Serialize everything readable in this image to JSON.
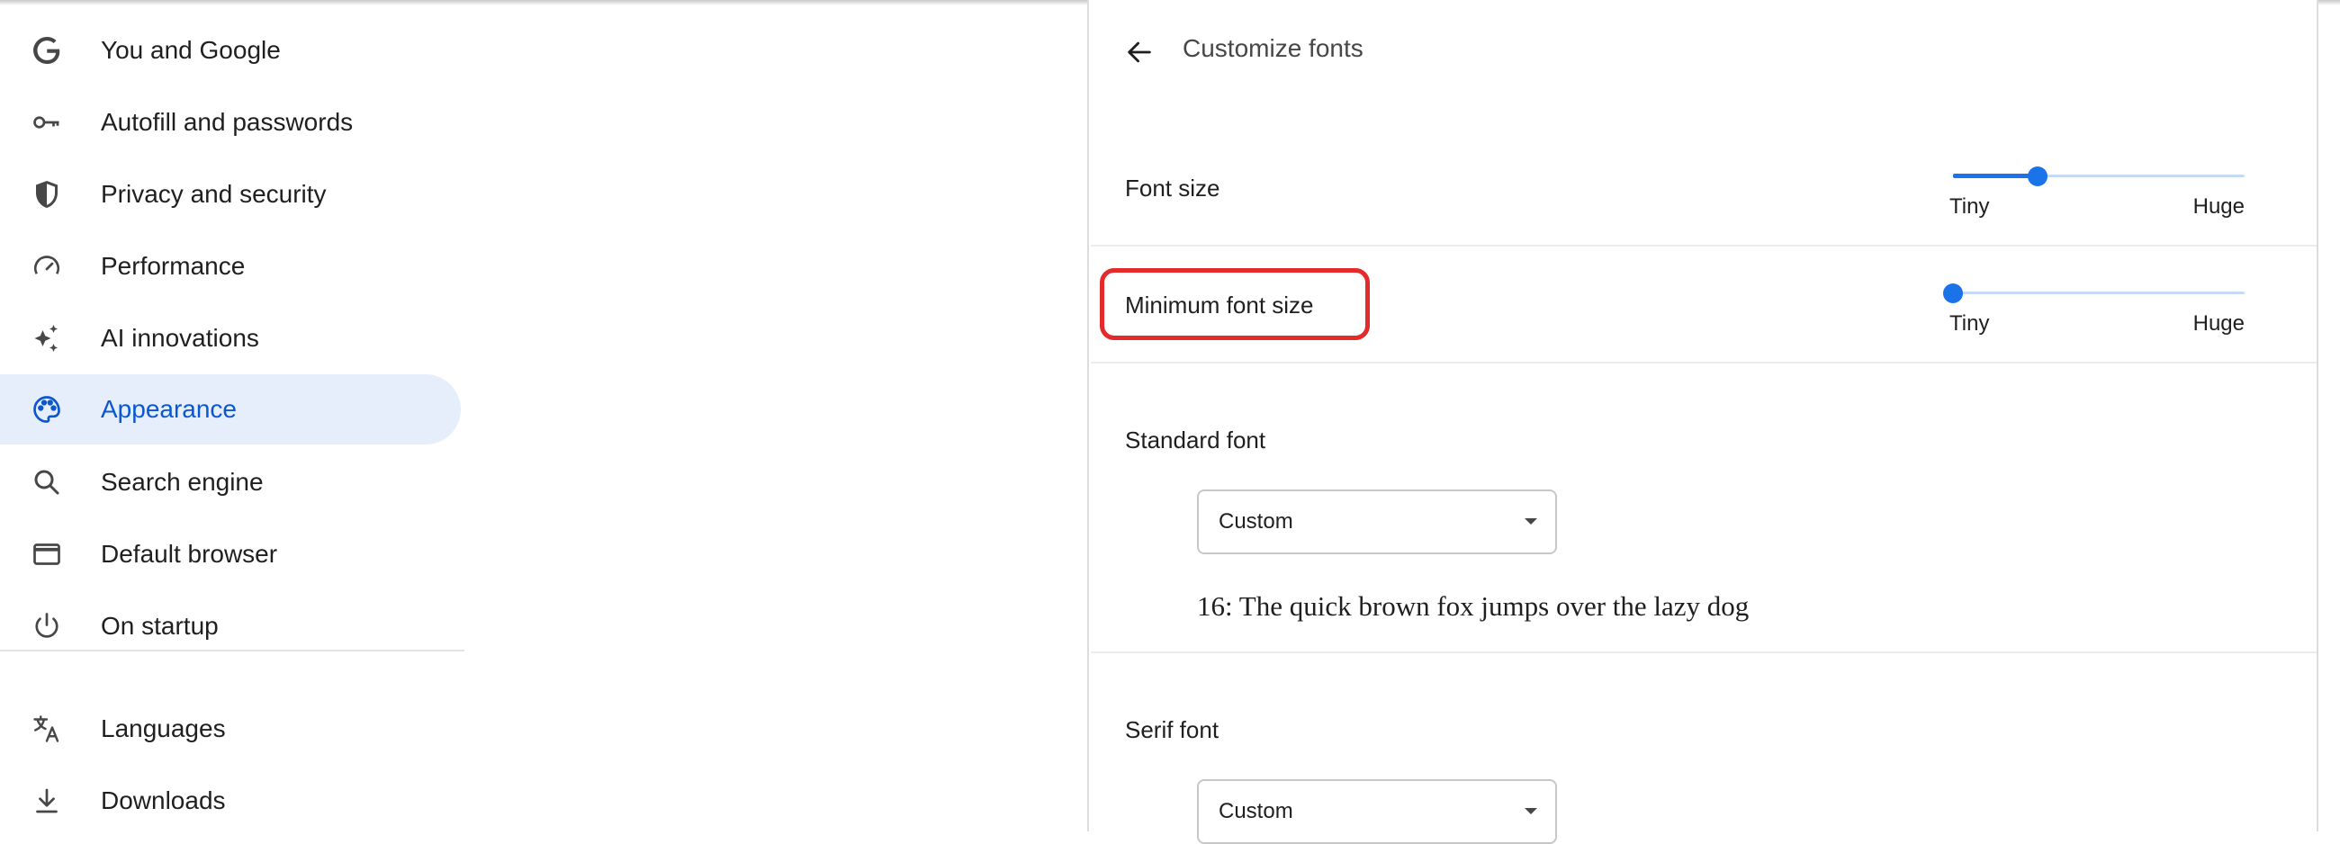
{
  "sidebar": {
    "items": [
      {
        "label": "You and Google",
        "icon": "google-icon"
      },
      {
        "label": "Autofill and passwords",
        "icon": "key-icon"
      },
      {
        "label": "Privacy and security",
        "icon": "shield-icon"
      },
      {
        "label": "Performance",
        "icon": "speedometer-icon"
      },
      {
        "label": "AI innovations",
        "icon": "sparkle-icon"
      },
      {
        "label": "Appearance",
        "icon": "palette-icon",
        "active": true
      },
      {
        "label": "Search engine",
        "icon": "search-icon"
      },
      {
        "label": "Default browser",
        "icon": "browser-window-icon"
      },
      {
        "label": "On startup",
        "icon": "power-icon"
      },
      {
        "label": "Languages",
        "icon": "translate-icon"
      },
      {
        "label": "Downloads",
        "icon": "download-icon"
      }
    ]
  },
  "page": {
    "title": "Customize fonts",
    "back_icon": "arrow-back-icon"
  },
  "font_size": {
    "label": "Font size",
    "min_label": "Tiny",
    "max_label": "Huge",
    "value_fraction": 0.29
  },
  "minimum_font_size": {
    "label": "Minimum font size",
    "min_label": "Tiny",
    "max_label": "Huge",
    "value_fraction": 0.0
  },
  "standard_font": {
    "heading": "Standard font",
    "selected": "Custom",
    "sample": "16: The quick brown fox jumps over the lazy dog"
  },
  "serif_font": {
    "heading": "Serif font",
    "selected": "Custom"
  },
  "colors": {
    "accent": "#1a73e8",
    "active_nav_bg": "#e6eefb",
    "active_nav_text": "#0b57d0",
    "highlight_border": "#e32b2b"
  }
}
